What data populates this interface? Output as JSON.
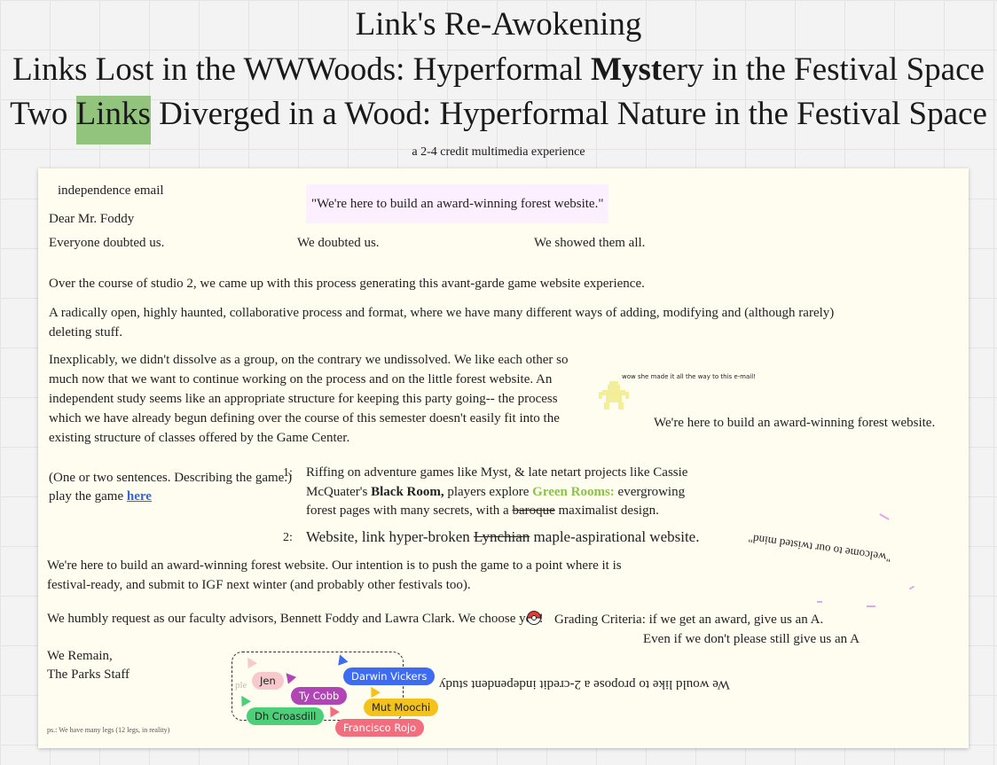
{
  "titles": {
    "line1": "Link's Re-Awokening",
    "line2_pre": "Links Lost in the WWWoods: Hyperformal ",
    "line2_bold": "Myst",
    "line2_post": "ery in the Festival Space",
    "line3_pre": "Two ",
    "line3_hl": "Links",
    "line3_post": " Diverged in a Wood: Hyperformal Nature in the Festival Space",
    "subtitle": "a 2-4 credit multimedia experience"
  },
  "email": {
    "heading": "independence email",
    "quote": "\"We're here to build an award-winning forest website.\"",
    "greeting": "Dear Mr. Foddy",
    "doubt1": "Everyone doubted us.",
    "doubt2": "We doubted us.",
    "doubt3": "We showed them all.",
    "para1": "Over the course of studio 2, we came up with this process generating this avant-garde game website experience.",
    "para2_line1": "A radically open, highly haunted, collaborative process and format, where we have many different ways of adding, modifying and (although rarely)",
    "para2_line2": "deleting stuff.",
    "para3_lines": [
      "Inexplicably, we didn't dissolve as a group, on the contrary we undissolved. We like each other so",
      "much now that we want to continue working on the process and on the little forest website. An",
      "independent study seems like an appropriate structure for keeping this party going-- the process",
      "which we have already begun defining over the course of this semester doesn't easily fit into the",
      "existing structure of classes offered by the Game Center."
    ],
    "tiny_note": "wow she made it all the way to this e-mail!",
    "side_repeat": "We're here to build an award-winning forest website.",
    "describe_line1": "(One or two sentences. Describing the game.)",
    "describe_line2_pre": "play the game ",
    "describe_link": "here",
    "item1_num": "1:",
    "item1_line1": "Riffing on adventure games like Myst, & late netart projects like Cassie",
    "item1_line2_pre": "McQuater's ",
    "item1_line2_bold": "Black Room,",
    "item1_line2_mid": " players explore ",
    "item1_line2_green": "Green Rooms:",
    "item1_line2_post": "  evergrowing",
    "item1_line3_pre": "forest pages with many secrets, with a ",
    "item1_line3_strike": "baroque",
    "item1_line3_post": " maximalist design.",
    "item2_num": "2:",
    "item2_pre": "Website, link hyper-broken ",
    "item2_strike": "Lynchian",
    "item2_post": " maple-aspirational website.",
    "upside_down_1": "\"welcome to our twisted mind\"",
    "intent_line1": "We're here to build an award-winning forest website. Our intention is to push the game to a point where it is",
    "intent_line2": "festival-ready, and submit to IGF next winter (and probably other festivals too).",
    "request": "We humbly request as our faculty advisors, Bennett Foddy and Lawra Clark.  We choose you!",
    "grading1": "Grading Criteria: if we get an award, give us an A.",
    "grading2": "Even if we don't please still give us an A",
    "signoff1": "We Remain,",
    "signoff2": "The Parks Staff",
    "upside_down_2": "We would like to propose a 2-credit independent study",
    "ps": "ps.: We have many legs (12 legs, in reality)",
    "faint_text": "ple"
  },
  "collaborators": [
    {
      "name": "Jen",
      "color": "#f8c9cc",
      "text_color": "#222"
    },
    {
      "name": "Darwin Vickers",
      "color": "#3d6cf2",
      "text_color": "#ffffff"
    },
    {
      "name": "Ty Cobb",
      "color": "#b145b5",
      "text_color": "#ffffff"
    },
    {
      "name": "Mut Moochi",
      "color": "#f4c21c",
      "text_color": "#222"
    },
    {
      "name": "Dh Croasdill",
      "color": "#4ccf78",
      "text_color": "#222"
    },
    {
      "name": "Francisco Rojo",
      "color": "#f26d7d",
      "text_color": "#ffffff"
    }
  ],
  "colors": {
    "highlight": "#93c47d",
    "quote_bg": "#fcefff",
    "card_bg": "#fffdf0",
    "green_text": "#8bc34a",
    "link": "#3366dd"
  },
  "icons": [
    "pokeball-icon",
    "pixel-sprite-icon",
    "cursor-icon"
  ]
}
